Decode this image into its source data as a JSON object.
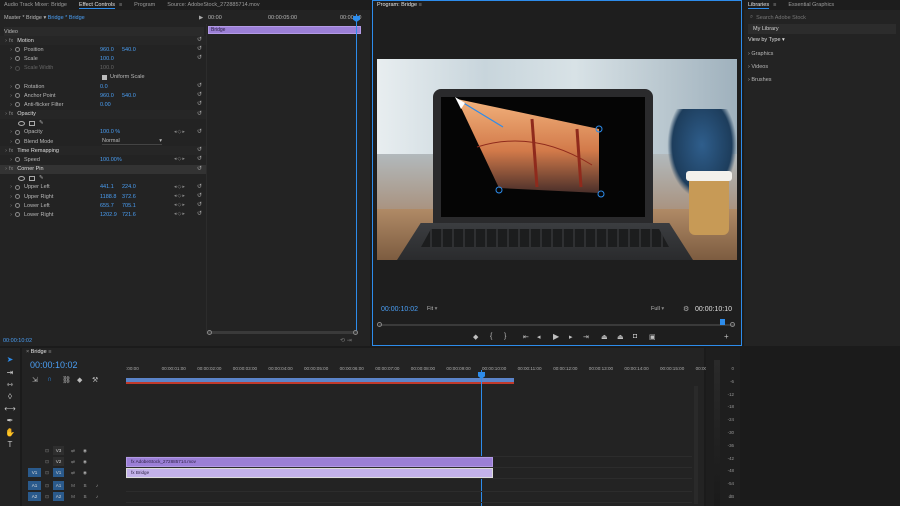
{
  "effect_controls": {
    "tabs": [
      "Audio Track Mixer: Bridge",
      "Effect Controls",
      "Program"
    ],
    "source_tab": "Source: AdobeStock_272885714.mov",
    "breadcrumb_master": "Master * Bridge",
    "breadcrumb_seq": "Bridge * Bridge",
    "mini_ruler": [
      "00:00",
      "00:00:05:00",
      "00:00:10"
    ],
    "clip_label": "Bridge",
    "section_video": "Video",
    "rows": [
      {
        "name": "Motion",
        "type": "fx"
      },
      {
        "name": "Position",
        "v1": "960.0",
        "v2": "540.0"
      },
      {
        "name": "Scale",
        "v1": "100.0"
      },
      {
        "name": "Scale Width",
        "v1": "100.0",
        "disabled": true
      },
      {
        "name": "Uniform Scale",
        "type": "checkbox"
      },
      {
        "name": "Rotation",
        "v1": "0.0"
      },
      {
        "name": "Anchor Point",
        "v1": "960.0",
        "v2": "540.0"
      },
      {
        "name": "Anti-flicker Filter",
        "v1": "0.00"
      },
      {
        "name": "Opacity",
        "type": "fx"
      },
      {
        "name": "Opacity",
        "v1": "100.0 %"
      },
      {
        "name": "Blend Mode",
        "select": "Normal"
      },
      {
        "name": "Time Remapping",
        "type": "fx"
      },
      {
        "name": "Speed",
        "v1": "100.00%"
      },
      {
        "name": "Corner Pin",
        "type": "fx"
      },
      {
        "name": "Upper Left",
        "v1": "441.1",
        "v2": "224.0"
      },
      {
        "name": "Upper Right",
        "v1": "1188.8",
        "v2": "372.6"
      },
      {
        "name": "Lower Left",
        "v1": "655.7",
        "v2": "705.1"
      },
      {
        "name": "Lower Right",
        "v1": "1202.9",
        "v2": "721.6"
      }
    ],
    "timecode": "00:00:10:02"
  },
  "program": {
    "tab": "Program: Bridge",
    "timecode_left": "00:00:10:02",
    "fit": "Fit",
    "full": "Full",
    "timecode_right": "00:00:10:10"
  },
  "libraries": {
    "tabs": [
      "Libraries",
      "Essential Graphics"
    ],
    "search_placeholder": "Search Adobe Stock",
    "library": "My Library",
    "view_by": "View by Type",
    "groups": [
      "Graphics",
      "Videos",
      "Brushes"
    ]
  },
  "timeline": {
    "tab": "Bridge",
    "timecode": "00:00:10:02",
    "ruler": [
      ":00:00",
      "00:00:01:00",
      "00:00:02:00",
      "00:00:03:00",
      "00:00:04:00",
      "00:00:05:00",
      "00:00:06:00",
      "00:00:07:00",
      "00:00:08:00",
      "00:00:09:00",
      "00:00:10:00",
      "00:00:11:00",
      "00:00:12:00",
      "00:00:13:00",
      "00:00:14:00",
      "00:00:15:00",
      "00:00:1"
    ],
    "tracks": [
      {
        "src": "",
        "name": "V3"
      },
      {
        "src": "",
        "name": "V2"
      },
      {
        "src": "V1",
        "name": "V1"
      },
      {
        "src": "A1",
        "name": "A1"
      },
      {
        "src": "A2",
        "name": "A2"
      }
    ],
    "clip_top": "AdobeStock_272885714.mov",
    "clip_bottom": "Bridge",
    "track_buttons": [
      "M",
      "S"
    ]
  },
  "meter_scale": [
    "0",
    "-6",
    "-12",
    "-18",
    "-24",
    "-30",
    "-36",
    "-42",
    "-48",
    "-54",
    "dB"
  ],
  "colors": {
    "accent": "#2d8ceb",
    "clip": "#9b7fd6",
    "track_selected": "#2a5a8c"
  }
}
